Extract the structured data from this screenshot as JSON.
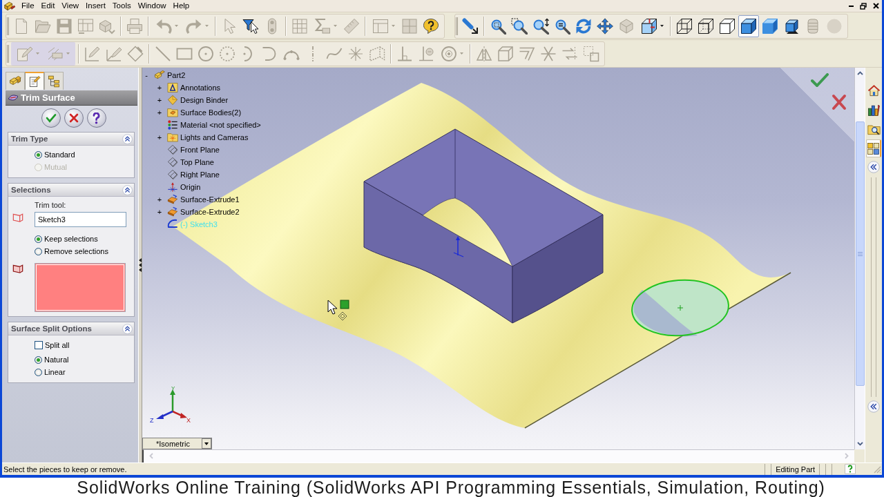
{
  "menu_bar": [
    "File",
    "Edit",
    "View",
    "Insert",
    "Tools",
    "Window",
    "Help"
  ],
  "toolbar_rows": [
    {
      "toolbars": [
        {
          "groups": [
            {
              "highlighted": false,
              "buttons": [
                {
                  "kind": "new",
                  "disabled": true,
                  "dropdown": false
                },
                {
                  "kind": "open",
                  "disabled": true,
                  "dropdown": false
                },
                {
                  "kind": "save",
                  "disabled": true,
                  "dropdown": false
                },
                {
                  "kind": "drawing",
                  "disabled": true,
                  "dropdown": false
                },
                {
                  "kind": "assembly",
                  "disabled": true,
                  "dropdown": false
                }
              ]
            },
            {
              "highlighted": false,
              "buttons": [
                {
                  "kind": "print",
                  "disabled": true,
                  "dropdown": false
                }
              ]
            },
            {
              "highlighted": false,
              "buttons": [
                {
                  "kind": "undo",
                  "disabled": true,
                  "dropdown": true
                },
                {
                  "kind": "redo",
                  "disabled": true,
                  "dropdown": true
                }
              ]
            },
            {
              "highlighted": false,
              "buttons": [
                {
                  "kind": "select",
                  "disabled": true,
                  "dropdown": false
                },
                {
                  "kind": "filter",
                  "disabled": false,
                  "dropdown": false
                },
                {
                  "kind": "rebuild",
                  "disabled": true,
                  "dropdown": false
                }
              ]
            },
            {
              "highlighted": false,
              "buttons": [
                {
                  "kind": "properties",
                  "disabled": true,
                  "dropdown": false
                },
                {
                  "kind": "equations",
                  "disabled": true,
                  "dropdown": true
                },
                {
                  "kind": "measure",
                  "disabled": true,
                  "dropdown": false
                }
              ]
            },
            {
              "highlighted": false,
              "buttons": [
                {
                  "kind": "panel",
                  "disabled": true,
                  "dropdown": true
                },
                {
                  "kind": "grid",
                  "disabled": true,
                  "dropdown": false
                },
                {
                  "kind": "help",
                  "disabled": false,
                  "dropdown": false
                }
              ]
            }
          ]
        },
        {
          "groups": [
            {
              "highlighted": false,
              "buttons": [
                {
                  "kind": "previous",
                  "disabled": false,
                  "dropdown": false
                }
              ]
            },
            {
              "highlighted": false,
              "buttons": [
                {
                  "kind": "zoomfit",
                  "disabled": false,
                  "dropdown": false
                },
                {
                  "kind": "zoomarea",
                  "disabled": false,
                  "dropdown": false
                },
                {
                  "kind": "zoom",
                  "disabled": false,
                  "dropdown": false
                },
                {
                  "kind": "zoomselection",
                  "disabled": false,
                  "dropdown": false
                },
                {
                  "kind": "rotate",
                  "disabled": false,
                  "dropdown": false
                },
                {
                  "kind": "pan",
                  "disabled": false,
                  "dropdown": false
                },
                {
                  "kind": "drawing3d",
                  "disabled": true,
                  "dropdown": false
                },
                {
                  "kind": "orientation",
                  "disabled": false,
                  "dropdown": true
                }
              ]
            },
            {
              "highlighted": false,
              "buttons": [
                {
                  "kind": "wireframe",
                  "disabled": false,
                  "dropdown": false,
                  "selected": false
                },
                {
                  "kind": "hiddenvisible",
                  "disabled": false,
                  "dropdown": false,
                  "selected": false
                },
                {
                  "kind": "hiddenremoved",
                  "disabled": false,
                  "dropdown": false,
                  "selected": false
                },
                {
                  "kind": "shadededges",
                  "disabled": false,
                  "dropdown": false,
                  "selected": true
                },
                {
                  "kind": "shaded",
                  "disabled": false,
                  "dropdown": false,
                  "selected": false
                },
                {
                  "kind": "shadows",
                  "disabled": false,
                  "dropdown": false,
                  "selected": false
                },
                {
                  "kind": "section",
                  "disabled": true,
                  "dropdown": false,
                  "selected": false
                },
                {
                  "kind": "realview",
                  "disabled": true,
                  "dropdown": false,
                  "selected": false
                }
              ]
            }
          ]
        }
      ]
    },
    {
      "toolbars": [
        {
          "groups": [
            {
              "highlighted": true,
              "buttons": [
                {
                  "kind": "sketch",
                  "disabled": true,
                  "dropdown": true
                },
                {
                  "kind": "dimension",
                  "disabled": true,
                  "dropdown": true
                }
              ]
            },
            {
              "highlighted": false,
              "buttons": [
                {
                  "kind": "editsketch",
                  "disabled": true,
                  "dropdown": false
                },
                {
                  "kind": "sketch3d",
                  "disabled": true,
                  "dropdown": false
                },
                {
                  "kind": "modify",
                  "disabled": true,
                  "dropdown": false
                }
              ]
            },
            {
              "highlighted": false,
              "buttons": [
                {
                  "kind": "line",
                  "disabled": true,
                  "dropdown": false
                },
                {
                  "kind": "rectangle",
                  "disabled": true,
                  "dropdown": false
                },
                {
                  "kind": "circle",
                  "disabled": true,
                  "dropdown": false
                },
                {
                  "kind": "perimetercircle",
                  "disabled": true,
                  "dropdown": false
                },
                {
                  "kind": "centerarc",
                  "disabled": true,
                  "dropdown": false
                },
                {
                  "kind": "tangentarc",
                  "disabled": true,
                  "dropdown": false
                },
                {
                  "kind": "threepointarc",
                  "disabled": true,
                  "dropdown": false
                },
                {
                  "kind": "centerline",
                  "disabled": true,
                  "dropdown": false
                },
                {
                  "kind": "spline",
                  "disabled": true,
                  "dropdown": false
                },
                {
                  "kind": "point",
                  "disabled": true,
                  "dropdown": false
                },
                {
                  "kind": "plane",
                  "disabled": true,
                  "dropdown": false
                }
              ]
            },
            {
              "highlighted": false,
              "buttons": [
                {
                  "kind": "relation",
                  "disabled": true,
                  "dropdown": false
                },
                {
                  "kind": "relations",
                  "disabled": true,
                  "dropdown": false
                },
                {
                  "kind": "offsetcircle",
                  "disabled": true,
                  "dropdown": true
                }
              ]
            },
            {
              "highlighted": false,
              "buttons": [
                {
                  "kind": "mirror",
                  "disabled": true,
                  "dropdown": false
                },
                {
                  "kind": "convert",
                  "disabled": true,
                  "dropdown": false
                },
                {
                  "kind": "offset",
                  "disabled": true,
                  "dropdown": false
                },
                {
                  "kind": "trim",
                  "disabled": true,
                  "dropdown": false
                },
                {
                  "kind": "move",
                  "disabled": true,
                  "dropdown": false
                },
                {
                  "kind": "copy",
                  "disabled": true,
                  "dropdown": false
                }
              ]
            }
          ]
        }
      ]
    }
  ],
  "property_manager": {
    "tabs": [
      {
        "kind": "tree",
        "selected": false
      },
      {
        "kind": "properties",
        "selected": true
      },
      {
        "kind": "configurations",
        "selected": false
      }
    ],
    "title": "Trim Surface",
    "sections": [
      {
        "title": "Trim Type",
        "expanded": true,
        "controls": [
          {
            "kind": "radio",
            "label": "Standard",
            "checked": true,
            "disabled": false
          },
          {
            "kind": "radio",
            "label": "Mutual",
            "checked": false,
            "disabled": true
          }
        ]
      },
      {
        "title": "Selections",
        "expanded": true,
        "controls": [
          {
            "kind": "field",
            "label": "Trim tool:",
            "value": "Sketch3"
          },
          {
            "kind": "radio",
            "label": "Keep selections",
            "checked": true,
            "disabled": false
          },
          {
            "kind": "radio",
            "label": "Remove selections",
            "checked": false,
            "disabled": false
          },
          {
            "kind": "list"
          }
        ]
      },
      {
        "title": "Surface Split Options",
        "expanded": true,
        "controls": [
          {
            "kind": "checkbox",
            "label": "Split all",
            "checked": false,
            "disabled": false
          },
          {
            "kind": "radio",
            "label": "Natural",
            "checked": true,
            "disabled": false
          },
          {
            "kind": "radio",
            "label": "Linear",
            "checked": false,
            "disabled": false
          }
        ]
      }
    ]
  },
  "feature_tree": {
    "items": [
      {
        "label": "Part2",
        "kind": "part",
        "toggle": "-",
        "selected": false,
        "children": [
          {
            "label": "Annotations",
            "kind": "annotations",
            "toggle": "+",
            "selected": false
          },
          {
            "label": "Design Binder",
            "kind": "binder",
            "toggle": "+",
            "selected": false
          },
          {
            "label": "Surface Bodies(2)",
            "kind": "bodies",
            "toggle": "+",
            "selected": false
          },
          {
            "label": "Material <not specified>",
            "kind": "material",
            "selected": false
          },
          {
            "label": "Lights and Cameras",
            "kind": "lights",
            "toggle": "+",
            "selected": false
          },
          {
            "label": "Front Plane",
            "kind": "plane",
            "selected": false
          },
          {
            "label": "Top Plane",
            "kind": "plane",
            "selected": false
          },
          {
            "label": "Right Plane",
            "kind": "plane",
            "selected": false
          },
          {
            "label": "Origin",
            "kind": "origin",
            "selected": false
          },
          {
            "label": "Surface-Extrude1",
            "kind": "extrude",
            "toggle": "+",
            "selected": false
          },
          {
            "label": "Surface-Extrude2",
            "kind": "extrude",
            "toggle": "+",
            "selected": false
          },
          {
            "label": "(-) Sketch3",
            "kind": "sketch",
            "selected": true
          }
        ]
      }
    ]
  },
  "viewport": {
    "orientation": "*Isometric",
    "triad": {
      "x": "X",
      "y": "Y",
      "z": "Z"
    }
  },
  "task_pane": {
    "tabs": [
      {
        "kind": "home",
        "selected": false
      },
      {
        "kind": "library",
        "selected": false
      },
      {
        "kind": "explorer",
        "selected": false
      },
      {
        "kind": "appearances",
        "selected": true
      }
    ]
  },
  "status_bar": {
    "message": "Select the pieces to keep or remove.",
    "mode": "Editing Part"
  },
  "caption": "SolidWorks Online Training (SolidWorks API Programming Essentials, Simulation, Routing)"
}
